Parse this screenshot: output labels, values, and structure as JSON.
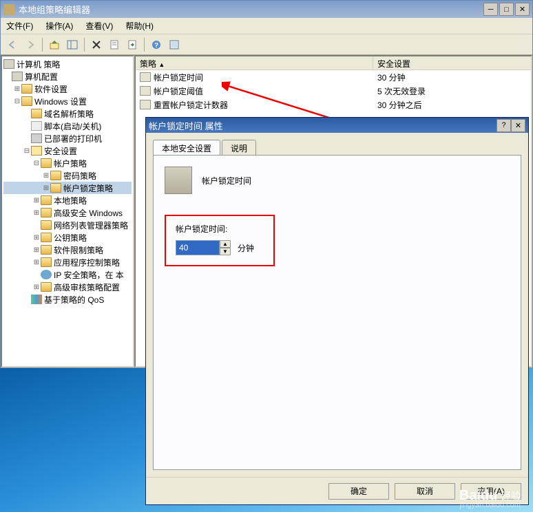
{
  "window": {
    "title": "本地组策略编辑器",
    "menu": {
      "file": "文件(F)",
      "action": "操作(A)",
      "view": "查看(V)",
      "help": "帮助(H)"
    }
  },
  "tree": {
    "root": "计算机 策略",
    "items": [
      {
        "label": "算机配置",
        "icon": "comp-icon",
        "ind": 0,
        "exp": ""
      },
      {
        "label": "软件设置",
        "icon": "folder-icon",
        "ind": 1,
        "exp": "⊞"
      },
      {
        "label": "Windows 设置",
        "icon": "folder-icon",
        "ind": 1,
        "exp": "⊟"
      },
      {
        "label": "域名解析策略",
        "icon": "folder-icon",
        "ind": 2,
        "exp": ""
      },
      {
        "label": "脚本(启动/关机)",
        "icon": "script-icon",
        "ind": 2,
        "exp": ""
      },
      {
        "label": "已部署的打印机",
        "icon": "printer-icon",
        "ind": 2,
        "exp": ""
      },
      {
        "label": "安全设置",
        "icon": "lock-icon",
        "ind": 2,
        "exp": "⊟"
      },
      {
        "label": "帐户策略",
        "icon": "folder-icon",
        "ind": 3,
        "exp": "⊟"
      },
      {
        "label": "密码策略",
        "icon": "folder-icon",
        "ind": 4,
        "exp": "⊞"
      },
      {
        "label": "帐户锁定策略",
        "icon": "folder-icon",
        "ind": 4,
        "exp": "⊞",
        "selected": true
      },
      {
        "label": "本地策略",
        "icon": "folder-icon",
        "ind": 3,
        "exp": "⊞"
      },
      {
        "label": "高级安全 Windows",
        "icon": "folder-icon",
        "ind": 3,
        "exp": "⊞"
      },
      {
        "label": "网络列表管理器策略",
        "icon": "folder-icon",
        "ind": 3,
        "exp": ""
      },
      {
        "label": "公钥策略",
        "icon": "folder-icon",
        "ind": 3,
        "exp": "⊞"
      },
      {
        "label": "软件限制策略",
        "icon": "folder-icon",
        "ind": 3,
        "exp": "⊞"
      },
      {
        "label": "应用程序控制策略",
        "icon": "folder-icon",
        "ind": 3,
        "exp": "⊞"
      },
      {
        "label": "IP 安全策略，在 本",
        "icon": "gear-icon",
        "ind": 3,
        "exp": ""
      },
      {
        "label": "高级审核策略配置",
        "icon": "folder-icon",
        "ind": 3,
        "exp": "⊞"
      },
      {
        "label": "基于策略的 QoS",
        "icon": "chart-icon",
        "ind": 2,
        "exp": ""
      }
    ]
  },
  "content": {
    "headers": {
      "policy": "策略",
      "setting": "安全设置"
    },
    "rows": [
      {
        "name": "帐户锁定时间",
        "value": "30 分钟"
      },
      {
        "name": "帐户锁定阈值",
        "value": "5 次无效登录"
      },
      {
        "name": "重置帐户锁定计数器",
        "value": "30 分钟之后"
      }
    ]
  },
  "dialog": {
    "title": "帐户锁定时间 属性",
    "tabs": {
      "local": "本地安全设置",
      "explain": "说明"
    },
    "item_name": "帐户锁定时间",
    "field_label": "帐户锁定时间:",
    "field_value": "40",
    "unit": "分钟",
    "buttons": {
      "ok": "确定",
      "cancel": "取消",
      "apply": "应用(A)"
    }
  },
  "watermark": {
    "brand": "Baidu",
    "suffix": "经验",
    "url": "jingyan.baidu.com"
  }
}
